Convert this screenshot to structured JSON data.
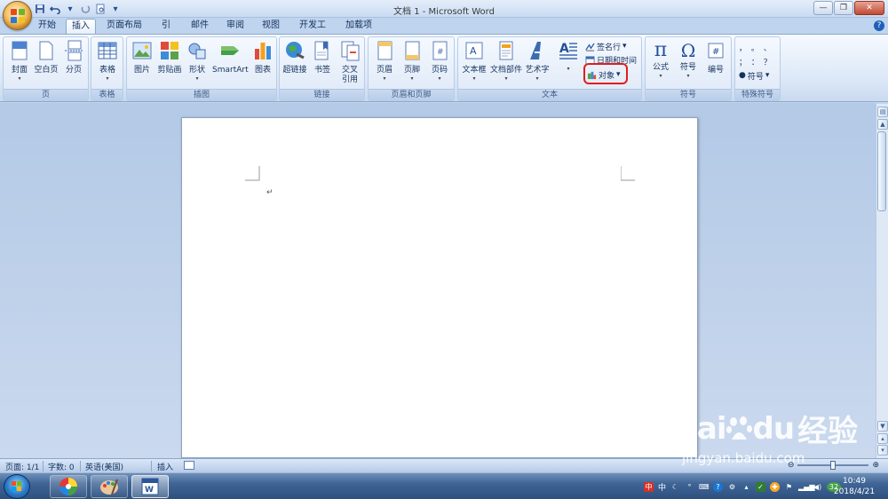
{
  "window": {
    "title": "文档 1 - Microsoft Word",
    "min_label": "—",
    "max_label": "❐",
    "close_label": "✕"
  },
  "qat": {
    "more": "▾"
  },
  "tabs": [
    {
      "label": "开始"
    },
    {
      "label": "插入",
      "active": true
    },
    {
      "label": "页面布局"
    },
    {
      "label": "引用"
    },
    {
      "label": "邮件"
    },
    {
      "label": "审阅"
    },
    {
      "label": "视图"
    },
    {
      "label": "开发工具"
    },
    {
      "label": "加载项"
    }
  ],
  "ribbon": {
    "groups": {
      "page": "页",
      "table": "表格",
      "illustrations": "插图",
      "links": "链接",
      "header_footer": "页眉和页脚",
      "text": "文本",
      "symbols": "符号",
      "special": "特殊符号"
    },
    "buttons": {
      "cover": "封面",
      "blank_page": "空白页",
      "page_break": "分页",
      "table": "表格",
      "picture": "图片",
      "clipart": "剪贴画",
      "shapes": "形状",
      "smartart": "SmartArt",
      "chart": "图表",
      "hyperlink": "超链接",
      "bookmark": "书签",
      "crossref_1": "交叉",
      "crossref_2": "引用",
      "header": "页眉",
      "footer": "页脚",
      "page_number": "页码",
      "textbox": "文本框",
      "quickparts": "文档部件",
      "wordart": "艺术字",
      "dropcap": "首字下沉",
      "signature": "签名行",
      "datetime": "日期和时间",
      "object": "对象",
      "equation": "公式",
      "symbol": "符号",
      "numbering": "编号",
      "special_symbol": "符号"
    },
    "dropdown": "▾",
    "punct": {
      "r1": "，  。  、",
      "r2": "；  ：  ？"
    }
  },
  "document": {
    "para_mark": "↵"
  },
  "status": {
    "page": "页面: 1/1",
    "words": "字数: 0",
    "language": "英语(美国)",
    "mode": "插入",
    "zoom_minus": "⊖",
    "zoom_plus": "⊕"
  },
  "taskbar": {
    "tray_lang": "中",
    "badge": "32",
    "time": "10:49",
    "date": "2018/4/21"
  },
  "watermark": {
    "brand": "Bai",
    "brand2": "du",
    "jy": "经验",
    "url": "jingyan.baidu.com"
  }
}
